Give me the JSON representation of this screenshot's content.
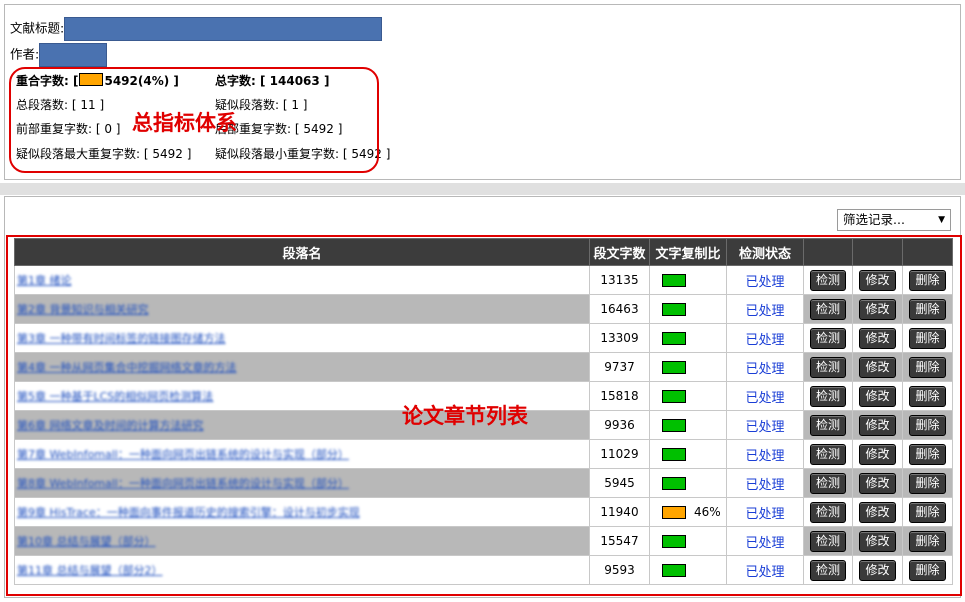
{
  "meta": {
    "title_label": "文献标题:",
    "author_label": "作者:"
  },
  "stats": {
    "overlap_label": "重合字数:",
    "overlap_value": "5492(4%)",
    "overlap_color": "#ffa500",
    "total_chars_label": "总字数:",
    "total_chars_value": "144063",
    "total_paragraphs": "总段落数: [ 11 ]",
    "similar_paragraphs": "疑似段落数: [ 1 ]",
    "front_repeat": "前部重复字数: [ 0 ]",
    "back_repeat": "后部重复字数: [ 5492 ]",
    "max_repeat": "疑似段落最大重复字数: [ 5492 ]",
    "min_repeat": "疑似段落最小重复字数: [ 5492 ]"
  },
  "annotations": {
    "top": "总指标体系",
    "table": "论文章节列表"
  },
  "filter": {
    "label": "筛选记录..."
  },
  "table": {
    "headers": [
      "段落名",
      "段文字数",
      "文字复制比",
      "检测状态",
      "",
      "",
      ""
    ],
    "buttons": {
      "detect": "检测",
      "modify": "修改",
      "delete": "删除"
    },
    "rows": [
      {
        "name": "第1章 绪论",
        "count": "13135",
        "ratio_color": "#00c000",
        "ratio_text": "",
        "status": "已处理"
      },
      {
        "name": "第2章 背景知识与相关研究",
        "count": "16463",
        "ratio_color": "#00c000",
        "ratio_text": "",
        "status": "已处理"
      },
      {
        "name": "第3章 一种带有时间标签的链接图存储方法",
        "count": "13309",
        "ratio_color": "#00c000",
        "ratio_text": "",
        "status": "已处理"
      },
      {
        "name": "第4章 一种从网页集合中挖掘网络文章的方法",
        "count": "9737",
        "ratio_color": "#00c000",
        "ratio_text": "",
        "status": "已处理"
      },
      {
        "name": "第5章 一种基于LCS的相似网页检测算法",
        "count": "15818",
        "ratio_color": "#00c000",
        "ratio_text": "",
        "status": "已处理"
      },
      {
        "name": "第6章 网络文章及时间的计算方法研究",
        "count": "9936",
        "ratio_color": "#00c000",
        "ratio_text": "",
        "status": "已处理"
      },
      {
        "name": "第7章 WebInfomall：一种面向网页出链系统的设计与实现（部分）",
        "count": "11029",
        "ratio_color": "#00c000",
        "ratio_text": "",
        "status": "已处理"
      },
      {
        "name": "第8章 WebInfomall：一种面向网页出链系统的设计与实现（部分）",
        "count": "5945",
        "ratio_color": "#00c000",
        "ratio_text": "",
        "status": "已处理"
      },
      {
        "name": "第9章 HisTrace：一种面向事件报道历史的搜索引擎：设计与初步实现",
        "count": "11940",
        "ratio_color": "#ffa500",
        "ratio_text": "46%",
        "status": "已处理"
      },
      {
        "name": "第10章 总结与展望（部分）",
        "count": "15547",
        "ratio_color": "#00c000",
        "ratio_text": "",
        "status": "已处理"
      },
      {
        "name": "第11章 总结与展望（部分2）",
        "count": "9593",
        "ratio_color": "#00c000",
        "ratio_text": "",
        "status": "已处理"
      }
    ]
  }
}
